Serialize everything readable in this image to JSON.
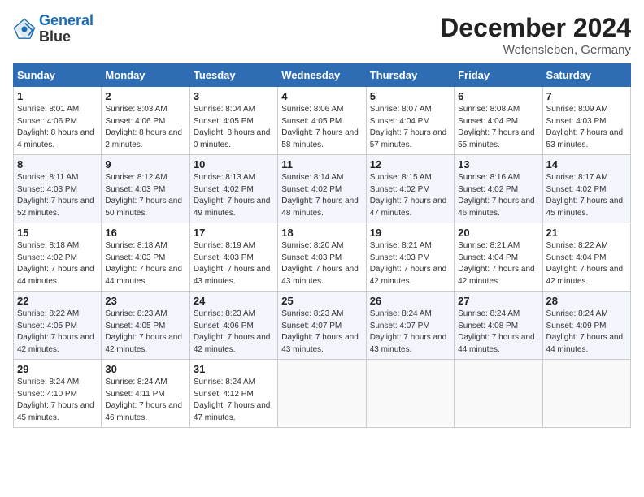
{
  "header": {
    "logo_line1": "General",
    "logo_line2": "Blue",
    "month": "December 2024",
    "location": "Wefensleben, Germany"
  },
  "days_of_week": [
    "Sunday",
    "Monday",
    "Tuesday",
    "Wednesday",
    "Thursday",
    "Friday",
    "Saturday"
  ],
  "weeks": [
    [
      {
        "num": "1",
        "sunrise": "Sunrise: 8:01 AM",
        "sunset": "Sunset: 4:06 PM",
        "daylight": "Daylight: 8 hours and 4 minutes."
      },
      {
        "num": "2",
        "sunrise": "Sunrise: 8:03 AM",
        "sunset": "Sunset: 4:06 PM",
        "daylight": "Daylight: 8 hours and 2 minutes."
      },
      {
        "num": "3",
        "sunrise": "Sunrise: 8:04 AM",
        "sunset": "Sunset: 4:05 PM",
        "daylight": "Daylight: 8 hours and 0 minutes."
      },
      {
        "num": "4",
        "sunrise": "Sunrise: 8:06 AM",
        "sunset": "Sunset: 4:05 PM",
        "daylight": "Daylight: 7 hours and 58 minutes."
      },
      {
        "num": "5",
        "sunrise": "Sunrise: 8:07 AM",
        "sunset": "Sunset: 4:04 PM",
        "daylight": "Daylight: 7 hours and 57 minutes."
      },
      {
        "num": "6",
        "sunrise": "Sunrise: 8:08 AM",
        "sunset": "Sunset: 4:04 PM",
        "daylight": "Daylight: 7 hours and 55 minutes."
      },
      {
        "num": "7",
        "sunrise": "Sunrise: 8:09 AM",
        "sunset": "Sunset: 4:03 PM",
        "daylight": "Daylight: 7 hours and 53 minutes."
      }
    ],
    [
      {
        "num": "8",
        "sunrise": "Sunrise: 8:11 AM",
        "sunset": "Sunset: 4:03 PM",
        "daylight": "Daylight: 7 hours and 52 minutes."
      },
      {
        "num": "9",
        "sunrise": "Sunrise: 8:12 AM",
        "sunset": "Sunset: 4:03 PM",
        "daylight": "Daylight: 7 hours and 50 minutes."
      },
      {
        "num": "10",
        "sunrise": "Sunrise: 8:13 AM",
        "sunset": "Sunset: 4:02 PM",
        "daylight": "Daylight: 7 hours and 49 minutes."
      },
      {
        "num": "11",
        "sunrise": "Sunrise: 8:14 AM",
        "sunset": "Sunset: 4:02 PM",
        "daylight": "Daylight: 7 hours and 48 minutes."
      },
      {
        "num": "12",
        "sunrise": "Sunrise: 8:15 AM",
        "sunset": "Sunset: 4:02 PM",
        "daylight": "Daylight: 7 hours and 47 minutes."
      },
      {
        "num": "13",
        "sunrise": "Sunrise: 8:16 AM",
        "sunset": "Sunset: 4:02 PM",
        "daylight": "Daylight: 7 hours and 46 minutes."
      },
      {
        "num": "14",
        "sunrise": "Sunrise: 8:17 AM",
        "sunset": "Sunset: 4:02 PM",
        "daylight": "Daylight: 7 hours and 45 minutes."
      }
    ],
    [
      {
        "num": "15",
        "sunrise": "Sunrise: 8:18 AM",
        "sunset": "Sunset: 4:02 PM",
        "daylight": "Daylight: 7 hours and 44 minutes."
      },
      {
        "num": "16",
        "sunrise": "Sunrise: 8:18 AM",
        "sunset": "Sunset: 4:03 PM",
        "daylight": "Daylight: 7 hours and 44 minutes."
      },
      {
        "num": "17",
        "sunrise": "Sunrise: 8:19 AM",
        "sunset": "Sunset: 4:03 PM",
        "daylight": "Daylight: 7 hours and 43 minutes."
      },
      {
        "num": "18",
        "sunrise": "Sunrise: 8:20 AM",
        "sunset": "Sunset: 4:03 PM",
        "daylight": "Daylight: 7 hours and 43 minutes."
      },
      {
        "num": "19",
        "sunrise": "Sunrise: 8:21 AM",
        "sunset": "Sunset: 4:03 PM",
        "daylight": "Daylight: 7 hours and 42 minutes."
      },
      {
        "num": "20",
        "sunrise": "Sunrise: 8:21 AM",
        "sunset": "Sunset: 4:04 PM",
        "daylight": "Daylight: 7 hours and 42 minutes."
      },
      {
        "num": "21",
        "sunrise": "Sunrise: 8:22 AM",
        "sunset": "Sunset: 4:04 PM",
        "daylight": "Daylight: 7 hours and 42 minutes."
      }
    ],
    [
      {
        "num": "22",
        "sunrise": "Sunrise: 8:22 AM",
        "sunset": "Sunset: 4:05 PM",
        "daylight": "Daylight: 7 hours and 42 minutes."
      },
      {
        "num": "23",
        "sunrise": "Sunrise: 8:23 AM",
        "sunset": "Sunset: 4:05 PM",
        "daylight": "Daylight: 7 hours and 42 minutes."
      },
      {
        "num": "24",
        "sunrise": "Sunrise: 8:23 AM",
        "sunset": "Sunset: 4:06 PM",
        "daylight": "Daylight: 7 hours and 42 minutes."
      },
      {
        "num": "25",
        "sunrise": "Sunrise: 8:23 AM",
        "sunset": "Sunset: 4:07 PM",
        "daylight": "Daylight: 7 hours and 43 minutes."
      },
      {
        "num": "26",
        "sunrise": "Sunrise: 8:24 AM",
        "sunset": "Sunset: 4:07 PM",
        "daylight": "Daylight: 7 hours and 43 minutes."
      },
      {
        "num": "27",
        "sunrise": "Sunrise: 8:24 AM",
        "sunset": "Sunset: 4:08 PM",
        "daylight": "Daylight: 7 hours and 44 minutes."
      },
      {
        "num": "28",
        "sunrise": "Sunrise: 8:24 AM",
        "sunset": "Sunset: 4:09 PM",
        "daylight": "Daylight: 7 hours and 44 minutes."
      }
    ],
    [
      {
        "num": "29",
        "sunrise": "Sunrise: 8:24 AM",
        "sunset": "Sunset: 4:10 PM",
        "daylight": "Daylight: 7 hours and 45 minutes."
      },
      {
        "num": "30",
        "sunrise": "Sunrise: 8:24 AM",
        "sunset": "Sunset: 4:11 PM",
        "daylight": "Daylight: 7 hours and 46 minutes."
      },
      {
        "num": "31",
        "sunrise": "Sunrise: 8:24 AM",
        "sunset": "Sunset: 4:12 PM",
        "daylight": "Daylight: 7 hours and 47 minutes."
      },
      null,
      null,
      null,
      null
    ]
  ]
}
